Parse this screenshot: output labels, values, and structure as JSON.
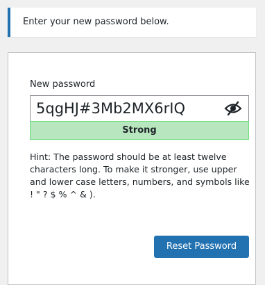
{
  "message": {
    "text": "Enter your new password below."
  },
  "form": {
    "password_label": "New password",
    "password_value": "5qgHJ#3Mb2MX6rIQ",
    "visibility_icon": "eye-slash-icon",
    "strength_text": "Strong",
    "hint_text": "Hint: The password should be at least twelve characters long. To make it stronger, use upper and lower case letters, numbers, and symbols like ! \" ? $ % ^ & ).",
    "submit_label": "Reset Password"
  },
  "colors": {
    "accent": "#2271b1",
    "strength_bg": "#b8e6bf",
    "strength_border": "#68de7c"
  }
}
